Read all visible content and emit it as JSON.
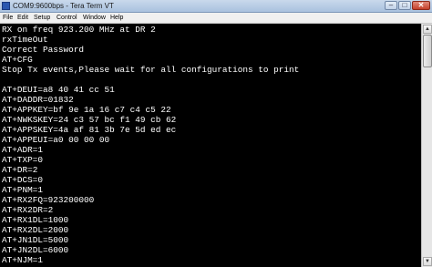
{
  "window": {
    "title": "COM9:9600bps - Tera Term VT",
    "icon": "teraterm-app-icon",
    "controls": {
      "minimize": "–",
      "maximize": "□",
      "close": "✕"
    }
  },
  "menu": {
    "items": [
      "File",
      "Edit",
      "Setup",
      "Control",
      "Window",
      "Help"
    ]
  },
  "terminal": {
    "lines": [
      "RX on freq 923.200 MHz at DR 2",
      "rxTimeOut",
      "Correct Password",
      "AT+CFG",
      "Stop Tx events,Please wait for all configurations to print",
      "",
      "AT+DEUI=a8 40 41 cc 51",
      "AT+DADDR=01832",
      "AT+APPKEY=bf 9e 1a 16 c7 c4 c5 22",
      "AT+NWKSKEY=24 c3 57 bc f1 49 cb 62",
      "AT+APPSKEY=4a af 81 3b 7e 5d ed ec",
      "AT+APPEUI=a0 00 00 00",
      "AT+ADR=1",
      "AT+TXP=0",
      "AT+DR=2",
      "AT+DCS=0",
      "AT+PNM=1",
      "AT+RX2FQ=923200000",
      "AT+RX2DR=2",
      "AT+RX1DL=1000",
      "AT+RX2DL=2000",
      "AT+JN1DL=5000",
      "AT+JN2DL=6000",
      "AT+NJM=1"
    ],
    "colors": {
      "background": "#000000",
      "foreground": "#ffffff"
    }
  },
  "scrollbar": {
    "up_icon": "▲",
    "down_icon": "▼"
  }
}
